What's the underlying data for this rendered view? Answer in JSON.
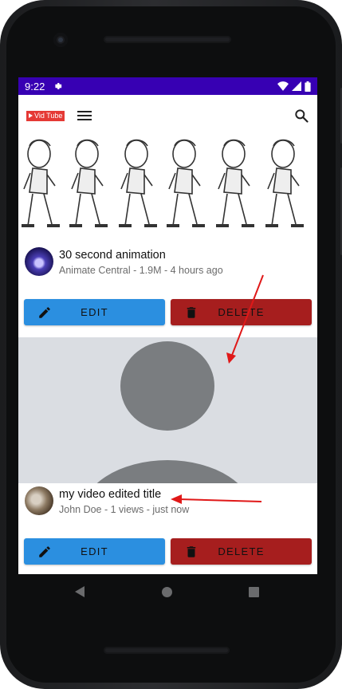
{
  "status_bar": {
    "time": "9:22"
  },
  "app": {
    "logo_text": "Vid Tube"
  },
  "videos": [
    {
      "title": "30 second animation",
      "subtitle": "Animate Central - 1.9M - 4 hours ago",
      "edit_label": "EDIT",
      "delete_label": "DELETE"
    },
    {
      "title": "my video edited title",
      "subtitle": "John Doe - 1 views - just now",
      "edit_label": "EDIT",
      "delete_label": "DELETE"
    }
  ],
  "colors": {
    "status_bar": "#3700b3",
    "edit_button": "#2b8fe0",
    "delete_button": "#a61e1e",
    "annotation_arrow": "#e01818"
  }
}
